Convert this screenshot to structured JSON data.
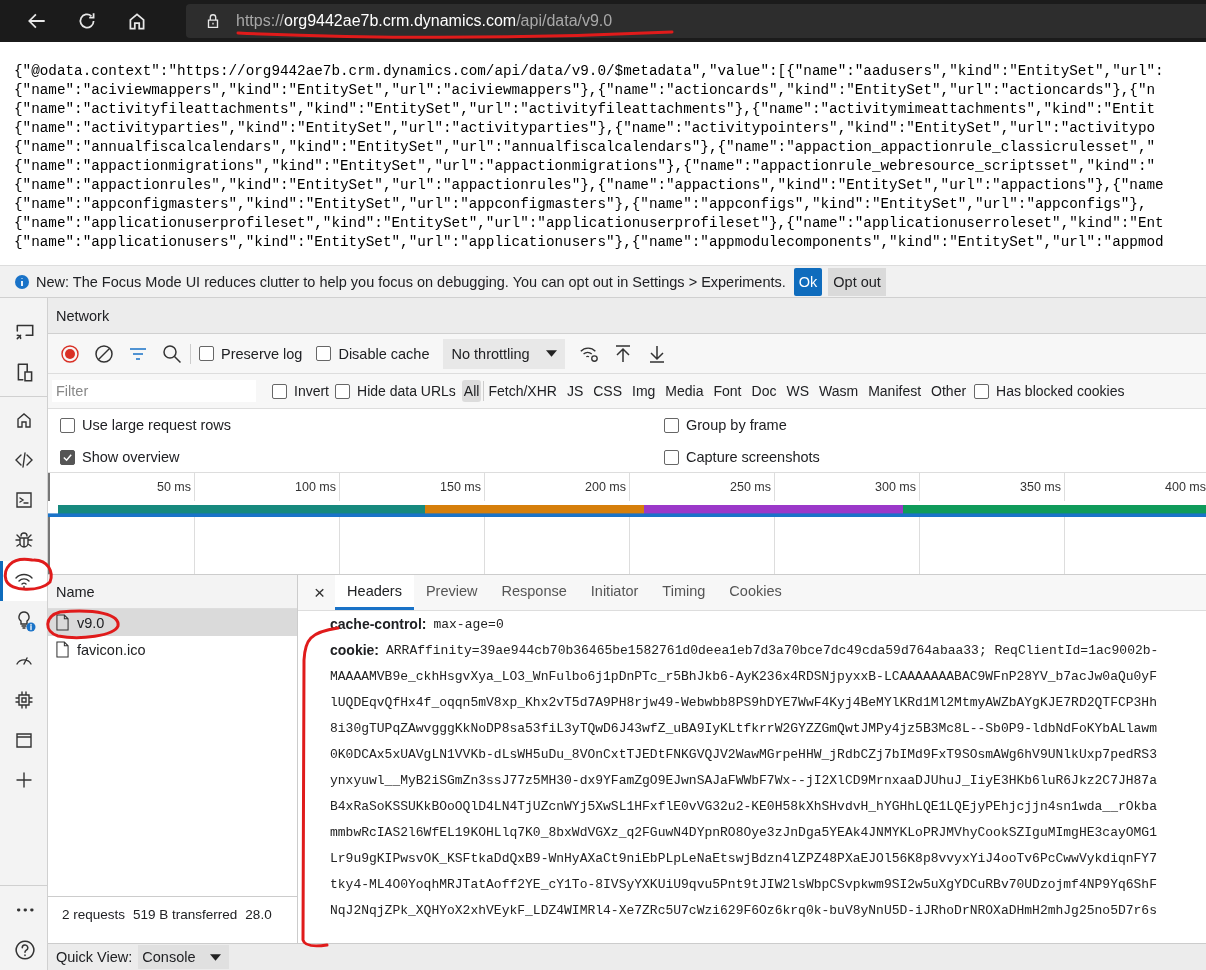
{
  "browser": {
    "url": {
      "scheme": "https://",
      "host": "org9442ae7b.crm.dynamics.com",
      "path": "/api/data/v9.0"
    }
  },
  "page": {
    "lines": [
      "{\"@odata.context\":\"https://org9442ae7b.crm.dynamics.com/api/data/v9.0/$metadata\",\"value\":[{\"name\":\"aadusers\",\"kind\":\"EntitySet\",\"url\":",
      "{\"name\":\"aciviewmappers\",\"kind\":\"EntitySet\",\"url\":\"aciviewmappers\"},{\"name\":\"actioncards\",\"kind\":\"EntitySet\",\"url\":\"actioncards\"},{\"n",
      "{\"name\":\"activityfileattachments\",\"kind\":\"EntitySet\",\"url\":\"activityfileattachments\"},{\"name\":\"activitymimeattachments\",\"kind\":\"Entit",
      "{\"name\":\"activityparties\",\"kind\":\"EntitySet\",\"url\":\"activityparties\"},{\"name\":\"activitypointers\",\"kind\":\"EntitySet\",\"url\":\"activitypo",
      "{\"name\":\"annualfiscalcalendars\",\"kind\":\"EntitySet\",\"url\":\"annualfiscalcalendars\"},{\"name\":\"appaction_appactionrule_classicrulesset\",\"",
      "{\"name\":\"appactionmigrations\",\"kind\":\"EntitySet\",\"url\":\"appactionmigrations\"},{\"name\":\"appactionrule_webresource_scriptsset\",\"kind\":\"",
      "{\"name\":\"appactionrules\",\"kind\":\"EntitySet\",\"url\":\"appactionrules\"},{\"name\":\"appactions\",\"kind\":\"EntitySet\",\"url\":\"appactions\"},{\"name",
      "{\"name\":\"appconfigmasters\",\"kind\":\"EntitySet\",\"url\":\"appconfigmasters\"},{\"name\":\"appconfigs\",\"kind\":\"EntitySet\",\"url\":\"appconfigs\"},",
      "{\"name\":\"applicationuserprofileset\",\"kind\":\"EntitySet\",\"url\":\"applicationuserprofileset\"},{\"name\":\"applicationuserroleset\",\"kind\":\"Ent",
      "{\"name\":\"applicationusers\",\"kind\":\"EntitySet\",\"url\":\"applicationusers\"},{\"name\":\"appmodulecomponents\",\"kind\":\"EntitySet\",\"url\":\"appmod"
    ]
  },
  "infobar": {
    "message": "New: The Focus Mode UI reduces clutter to help you focus on debugging. You can opt out in Settings > Experiments.",
    "buttons": [
      {
        "label": "Ok",
        "kind": "primary"
      },
      {
        "label": "Opt out",
        "kind": "secondary"
      }
    ]
  },
  "devtools": {
    "activity_bar": {
      "top": [
        {
          "kind": "screencast",
          "selected": false
        },
        {
          "kind": "device",
          "selected": false
        }
      ],
      "tools": [
        {
          "kind": "home",
          "selected": false
        },
        {
          "kind": "code",
          "selected": false
        },
        {
          "kind": "console",
          "selected": false
        },
        {
          "kind": "bug",
          "selected": false
        },
        {
          "kind": "network",
          "selected": true
        },
        {
          "kind": "lightbulb",
          "selected": false,
          "badge": true
        },
        {
          "kind": "gauge",
          "selected": false
        },
        {
          "kind": "chip",
          "selected": false
        },
        {
          "kind": "window",
          "selected": false
        },
        {
          "kind": "plus",
          "selected": false
        }
      ],
      "bottom": [
        {
          "kind": "more",
          "selected": false
        },
        {
          "kind": "help",
          "selected": false
        }
      ]
    },
    "panel_title": "Network",
    "toolbar": {
      "recording": true,
      "checkboxes": [
        {
          "label": "Preserve log",
          "checked": false
        },
        {
          "label": "Disable cache",
          "checked": false
        }
      ],
      "throttling": "No throttling"
    },
    "filter": {
      "placeholder": "Filter",
      "checkboxes": [
        {
          "label": "Invert",
          "checked": false
        },
        {
          "label": "Hide data URLs",
          "checked": false
        }
      ],
      "types": [
        {
          "label": "All",
          "selected": true
        },
        {
          "label": "Fetch/XHR",
          "selected": false
        },
        {
          "label": "JS",
          "selected": false
        },
        {
          "label": "CSS",
          "selected": false
        },
        {
          "label": "Img",
          "selected": false
        },
        {
          "label": "Media",
          "selected": false
        },
        {
          "label": "Font",
          "selected": false
        },
        {
          "label": "Doc",
          "selected": false
        },
        {
          "label": "WS",
          "selected": false
        },
        {
          "label": "Wasm",
          "selected": false
        },
        {
          "label": "Manifest",
          "selected": false
        },
        {
          "label": "Other",
          "selected": false
        }
      ],
      "extra_checkbox": {
        "label": "Has blocked cookies",
        "checked": false
      }
    },
    "options": [
      {
        "label": "Use large request rows",
        "checked": false
      },
      {
        "label": "Group by frame",
        "checked": false
      },
      {
        "label": "Show overview",
        "checked": true
      },
      {
        "label": "Capture screenshots",
        "checked": false
      }
    ],
    "overview": {
      "ticks": [
        "50 ms",
        "100 ms",
        "150 ms",
        "200 ms",
        "250 ms",
        "300 ms",
        "350 ms",
        "400 ms"
      ]
    },
    "requests": {
      "column": "Name",
      "rows": [
        {
          "name": "v9.0",
          "selected": true
        },
        {
          "name": "favicon.ico",
          "selected": false
        }
      ],
      "summary": [
        "2 requests",
        "519 B transferred",
        "28.0"
      ]
    },
    "details": {
      "close": "×",
      "tabs": [
        {
          "label": "Headers",
          "selected": true
        },
        {
          "label": "Preview",
          "selected": false
        },
        {
          "label": "Response",
          "selected": false
        },
        {
          "label": "Initiator",
          "selected": false
        },
        {
          "label": "Timing",
          "selected": false
        },
        {
          "label": "Cookies",
          "selected": false
        }
      ],
      "headers": [
        {
          "name": "cache-control:",
          "lines": [
            "max-age=0"
          ]
        },
        {
          "name": "cookie:",
          "lines": [
            "ARRAffinity=39ae944cb70b36465be1582761d0deea1eb7d3a70bce7dc49cda59d764abaa33; ReqClientId=1ac9002b-",
            "MAAAAMVB9e_ckhHsgvXya_LO3_WnFulbo6j1pDnPTc_r5BhJkb6-AyK236x4RDSNjpyxxB-LCAAAAAAABAC9WFnP28YV_b7acJw0aQu0yF",
            "lUQDEqvQfHx4f_oqqn5mV8xp_Khx2vT5d7A9PH8rjw49-Webwbb8PS9hDYE7WwF4Kyj4BeMYlKRd1Ml2MtmyAWZbAYgKJE7RD2QTFCP3Hh",
            "8i30gTUPqZAwvgggKkNoDP8sa53fiL3yTQwD6J43wfZ_uBA9IyKLtfkrrW2GYZZGmQwtJMPy4jz5B3Mc8L--Sb0P9-ldbNdFoKYbALlawm",
            "0K0DCAx5xUAVgLN1VVKb-dLsWH5uDu_8VOnCxtTJEDtFNKGVQJV2WawMGrpeHHW_jRdbCZj7bIMd9FxT9SOsmAWg6hV9UNlkUxp7pedRS3",
            "ynxyuwl__MyB2iSGmZn3ssJ77z5MH30-dx9YFamZgO9EJwnSAJaFWWbF7Wx--jI2XlCD9MrnxaaDJUhuJ_IiyE3HKb6luR6Jkz2C7JH87a",
            "B4xRaSoKSSUKkBOoOQlD4LN4TjUZcnWYj5XwSL1HFxflE0vVG32u2-KE0H58kXhSHvdvH_hYGHhLQE1LQEjyPEhjcjjn4sn1wda__rOkba",
            "mmbwRcIAS2l6WfEL19KOHLlq7K0_8bxWdVGXz_q2FGuwN4DYpnRO8Oye3zJnDga5YEAk4JNMYKLoPRJMVhyCookSZIguMImgHE3cayOMG1",
            "Lr9u9gKIPwsvOK_KSFtkaDdQxB9-WnHyAXaCt9niEbPLpLeNaEtswjBdzn4lZPZ48PXaEJOl56K8p8vvyxYiJ4ooTv6PcCwwVykdiqnFY7",
            "tky4-ML4O0YoqhMRJTatAoff2YE_cY1To-8IVSyYXKUiU9qvu5Pnt9tJIW2lsWbpCSvpkwm9SI2w5uXgYDCuRBv70UDzojmf4NP9Yq6ShF",
            "NqJ2NqjZPk_XQHYoX2xhVEykF_LDZ4WIMRl4-Xe7ZRc5U7cWzi629F6Oz6krq0k-buV8yNnU5D-iJRhoDrNROXaDHmH2mhJg25no5D7r6s"
          ]
        }
      ]
    },
    "quick_view": {
      "label": "Quick View:",
      "value": "Console"
    }
  }
}
